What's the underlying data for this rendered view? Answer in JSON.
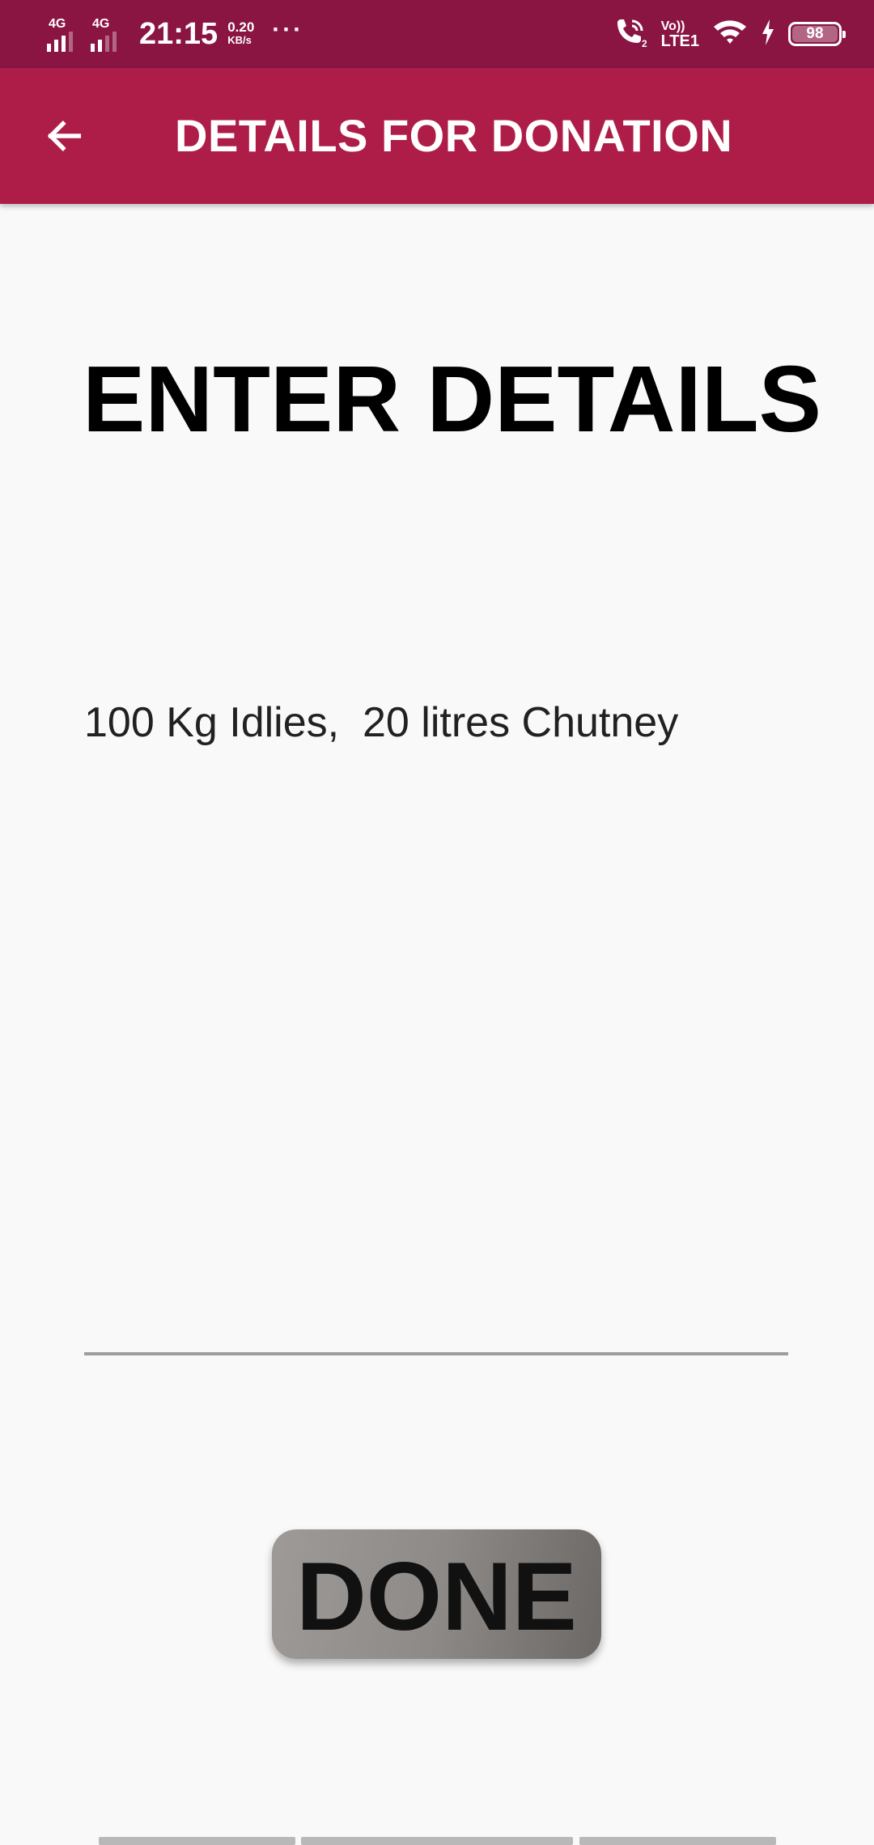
{
  "status_bar": {
    "sim1_network": "4G",
    "sim2_network": "4G",
    "time": "21:15",
    "speed_value": "0.20",
    "speed_unit": "KB/s",
    "more_indicator": "···",
    "volte_label": "Vo))",
    "lte_label": "LTE1",
    "battery_level": "98",
    "icons": [
      "signal-icon",
      "wifi-calling-icon",
      "wifi-icon",
      "charging-icon",
      "battery-icon"
    ]
  },
  "app_bar": {
    "back_icon": "arrow-left-icon",
    "title": "DETAILS FOR DONATION",
    "color": "#ad1d48",
    "status_color": "#8a1442"
  },
  "main": {
    "heading": "ENTER DETAILS",
    "details_value": "100 Kg Idlies,  20 litres Chutney",
    "done_label": "DONE"
  }
}
